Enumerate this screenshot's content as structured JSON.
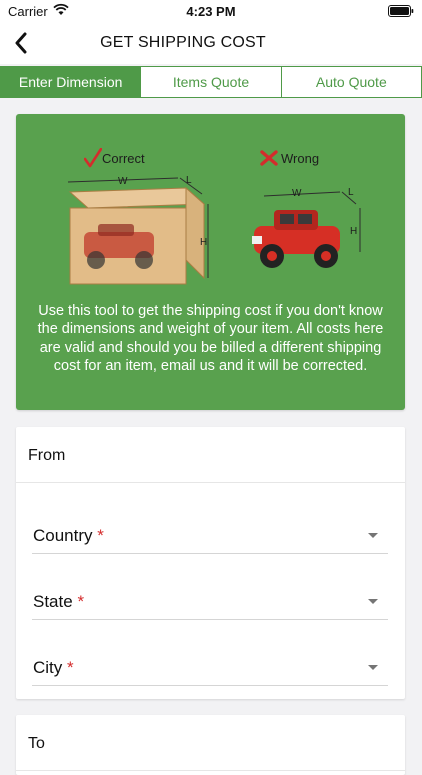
{
  "status": {
    "carrier": "Carrier",
    "time": "4:23 PM"
  },
  "nav": {
    "title": "GET SHIPPING COST"
  },
  "tabs": [
    {
      "label": "Enter Dimension",
      "active": true
    },
    {
      "label": "Items Quote",
      "active": false
    },
    {
      "label": "Auto Quote",
      "active": false
    }
  ],
  "banner": {
    "correct_label": "Correct",
    "wrong_label": "Wrong",
    "dim_w": "W",
    "dim_l": "L",
    "dim_h": "H",
    "text": "Use this tool to get the shipping cost if you don't know the dimensions and weight of your item. All costs here are valid and should you be billed a different shipping cost for an item, email us and it will be corrected."
  },
  "from_card": {
    "header": "From",
    "fields": [
      {
        "label": "Country",
        "required_mark": "*"
      },
      {
        "label": "State",
        "required_mark": "*"
      },
      {
        "label": "City",
        "required_mark": "*"
      }
    ]
  },
  "to_card": {
    "header": "To"
  },
  "colors": {
    "accent": "#4f9a48",
    "banner": "#59a14e",
    "required": "#d42c2c"
  }
}
